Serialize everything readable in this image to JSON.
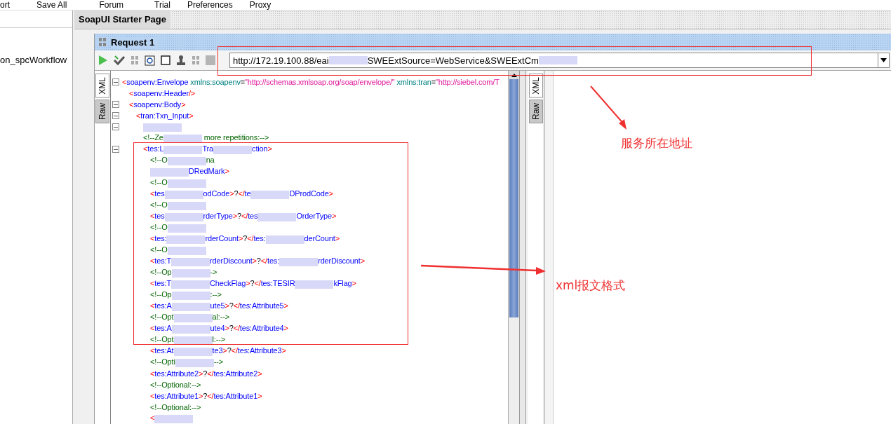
{
  "menu": [
    "ort",
    "Save All",
    "Forum",
    "Trial",
    "Preferences",
    "Proxy"
  ],
  "navigator": {
    "item": "on_spcWorkflow"
  },
  "tabs": [
    {
      "label": "SoapUI Starter Page",
      "selected": true
    }
  ],
  "request": {
    "title": "Request 1",
    "url_parts": [
      {
        "kind": "text",
        "text": "http://172.19.100.88/eai"
      },
      {
        "kind": "redacted"
      },
      {
        "kind": "text",
        "text": "SWEExtSource=WebService&SWEExtCm"
      },
      {
        "kind": "redacted"
      }
    ]
  },
  "editor_tabs": [
    {
      "label": "XML",
      "selected": true
    },
    {
      "label": "Raw",
      "selected": false
    }
  ],
  "response_tabs": [
    {
      "label": "XML",
      "selected": true
    },
    {
      "label": "Raw",
      "selected": false
    }
  ],
  "lines": [
    {
      "fold": true,
      "parts": [
        {
          "kind": "punct",
          "text": "<"
        },
        {
          "kind": "name",
          "text": "soapenv:Envelope"
        },
        {
          "kind": "attr",
          "text": " xmlns:soapenv"
        },
        {
          "kind": "plain",
          "text": "="
        },
        {
          "kind": "value",
          "text": "\"http://schemas.xmlsoap.org/soap/envelope/\""
        },
        {
          "kind": "attr",
          "text": " xmlns:tran"
        },
        {
          "kind": "plain",
          "text": "="
        },
        {
          "kind": "value",
          "text": "\"http://siebel.com/T"
        }
      ],
      "children": [
        {
          "parts": [
            {
              "kind": "punct",
              "text": "<"
            },
            {
              "kind": "name",
              "text": "soapenv:Header"
            },
            {
              "kind": "punct",
              "text": "/>"
            }
          ]
        },
        {
          "fold": true,
          "parts": [
            {
              "kind": "punct",
              "text": "<"
            },
            {
              "kind": "name",
              "text": "soapenv:Body"
            },
            {
              "kind": "punct",
              "text": ">"
            }
          ],
          "children": [
            {
              "fold": true,
              "parts": [
                {
                  "kind": "punct",
                  "text": "<"
                },
                {
                  "kind": "name",
                  "text": "tran:Txn_Input"
                },
                {
                  "kind": "punct",
                  "text": ">"
                }
              ],
              "children": [
                {
                  "fold": true,
                  "parts": [
                    {
                      "kind": "redacted"
                    }
                  ]
                },
                {
                  "parts": [
                    {
                      "kind": "comment",
                      "text": "<!--Ze"
                    },
                    {
                      "kind": "redacted"
                    },
                    {
                      "kind": "comment",
                      "text": " more repetitions:-->"
                    }
                  ]
                },
                {
                  "fold": true,
                  "parts": [
                    {
                      "kind": "punct",
                      "text": "<"
                    },
                    {
                      "kind": "name",
                      "text": "tes:L"
                    },
                    {
                      "kind": "redacted"
                    },
                    {
                      "kind": "name",
                      "text": "Tra"
                    },
                    {
                      "kind": "redacted"
                    },
                    {
                      "kind": "name",
                      "text": "ction"
                    },
                    {
                      "kind": "punct",
                      "text": ">"
                    }
                  ],
                  "children": [
                    {
                      "parts": [
                        {
                          "kind": "comment",
                          "text": "<!--O"
                        },
                        {
                          "kind": "redacted"
                        },
                        {
                          "kind": "comment",
                          "text": "na"
                        }
                      ]
                    },
                    {
                      "parts": [
                        {
                          "kind": "redacted"
                        },
                        {
                          "kind": "name",
                          "text": "DRedMark"
                        },
                        {
                          "kind": "punct",
                          "text": ">"
                        }
                      ]
                    },
                    {
                      "parts": [
                        {
                          "kind": "comment",
                          "text": "<!--O"
                        },
                        {
                          "kind": "redacted"
                        }
                      ]
                    },
                    {
                      "parts": [
                        {
                          "kind": "punct",
                          "text": "<"
                        },
                        {
                          "kind": "name",
                          "text": "tes"
                        },
                        {
                          "kind": "redacted"
                        },
                        {
                          "kind": "name",
                          "text": "odCode"
                        },
                        {
                          "kind": "punct",
                          "text": ">"
                        },
                        {
                          "kind": "plain",
                          "text": "?"
                        },
                        {
                          "kind": "punct",
                          "text": "</"
                        },
                        {
                          "kind": "name",
                          "text": "te"
                        },
                        {
                          "kind": "redacted"
                        },
                        {
                          "kind": "name",
                          "text": "DProdCode"
                        },
                        {
                          "kind": "punct",
                          "text": ">"
                        }
                      ]
                    },
                    {
                      "parts": [
                        {
                          "kind": "comment",
                          "text": "<!--O"
                        },
                        {
                          "kind": "redacted"
                        }
                      ]
                    },
                    {
                      "parts": [
                        {
                          "kind": "punct",
                          "text": "<"
                        },
                        {
                          "kind": "name",
                          "text": "tes"
                        },
                        {
                          "kind": "redacted"
                        },
                        {
                          "kind": "name",
                          "text": "rderType"
                        },
                        {
                          "kind": "punct",
                          "text": ">"
                        },
                        {
                          "kind": "plain",
                          "text": "?"
                        },
                        {
                          "kind": "punct",
                          "text": "</"
                        },
                        {
                          "kind": "name",
                          "text": "tes"
                        },
                        {
                          "kind": "redacted"
                        },
                        {
                          "kind": "name",
                          "text": "OrderType"
                        },
                        {
                          "kind": "punct",
                          "text": ">"
                        }
                      ]
                    },
                    {
                      "parts": [
                        {
                          "kind": "comment",
                          "text": "<!--O"
                        },
                        {
                          "kind": "redacted"
                        }
                      ]
                    },
                    {
                      "parts": [
                        {
                          "kind": "punct",
                          "text": "<"
                        },
                        {
                          "kind": "name",
                          "text": "tes:"
                        },
                        {
                          "kind": "redacted"
                        },
                        {
                          "kind": "name",
                          "text": "rderCount"
                        },
                        {
                          "kind": "punct",
                          "text": ">"
                        },
                        {
                          "kind": "plain",
                          "text": "?"
                        },
                        {
                          "kind": "punct",
                          "text": "</"
                        },
                        {
                          "kind": "name",
                          "text": "tes:"
                        },
                        {
                          "kind": "redacted"
                        },
                        {
                          "kind": "name",
                          "text": "derCount"
                        },
                        {
                          "kind": "punct",
                          "text": ">"
                        }
                      ]
                    },
                    {
                      "parts": [
                        {
                          "kind": "comment",
                          "text": "<!--O"
                        },
                        {
                          "kind": "redacted"
                        }
                      ]
                    },
                    {
                      "parts": [
                        {
                          "kind": "punct",
                          "text": "<"
                        },
                        {
                          "kind": "name",
                          "text": "tes:T"
                        },
                        {
                          "kind": "redacted"
                        },
                        {
                          "kind": "name",
                          "text": "rderDiscount"
                        },
                        {
                          "kind": "punct",
                          "text": ">"
                        },
                        {
                          "kind": "plain",
                          "text": "?"
                        },
                        {
                          "kind": "punct",
                          "text": "</"
                        },
                        {
                          "kind": "name",
                          "text": "tes:"
                        },
                        {
                          "kind": "redacted"
                        },
                        {
                          "kind": "name",
                          "text": "rderDiscount"
                        },
                        {
                          "kind": "punct",
                          "text": ">"
                        }
                      ]
                    },
                    {
                      "parts": [
                        {
                          "kind": "comment",
                          "text": "<!--Op"
                        },
                        {
                          "kind": "redacted"
                        },
                        {
                          "kind": "comment",
                          "text": "->"
                        }
                      ]
                    },
                    {
                      "parts": [
                        {
                          "kind": "punct",
                          "text": "<"
                        },
                        {
                          "kind": "name",
                          "text": "tes:T"
                        },
                        {
                          "kind": "redacted"
                        },
                        {
                          "kind": "name",
                          "text": "CheckFlag"
                        },
                        {
                          "kind": "punct",
                          "text": ">"
                        },
                        {
                          "kind": "plain",
                          "text": "?"
                        },
                        {
                          "kind": "punct",
                          "text": "</"
                        },
                        {
                          "kind": "name",
                          "text": "tes:TESIR"
                        },
                        {
                          "kind": "redacted"
                        },
                        {
                          "kind": "name",
                          "text": "kFlag"
                        },
                        {
                          "kind": "punct",
                          "text": ">"
                        }
                      ]
                    },
                    {
                      "parts": [
                        {
                          "kind": "comment",
                          "text": "<!--Op"
                        },
                        {
                          "kind": "redacted"
                        },
                        {
                          "kind": "comment",
                          "text": ":-->"
                        }
                      ]
                    },
                    {
                      "parts": [
                        {
                          "kind": "punct",
                          "text": "<"
                        },
                        {
                          "kind": "name",
                          "text": "tes:A"
                        },
                        {
                          "kind": "redacted"
                        },
                        {
                          "kind": "name",
                          "text": "ute5"
                        },
                        {
                          "kind": "punct",
                          "text": ">"
                        },
                        {
                          "kind": "plain",
                          "text": "?"
                        },
                        {
                          "kind": "punct",
                          "text": "</"
                        },
                        {
                          "kind": "name",
                          "text": "tes:Attribute5"
                        },
                        {
                          "kind": "punct",
                          "text": ">"
                        }
                      ]
                    },
                    {
                      "parts": [
                        {
                          "kind": "comment",
                          "text": "<!--Opt"
                        },
                        {
                          "kind": "redacted"
                        },
                        {
                          "kind": "comment",
                          "text": "al:-->"
                        }
                      ]
                    },
                    {
                      "parts": [
                        {
                          "kind": "punct",
                          "text": "<"
                        },
                        {
                          "kind": "name",
                          "text": "tes:A"
                        },
                        {
                          "kind": "redacted"
                        },
                        {
                          "kind": "name",
                          "text": "ute4"
                        },
                        {
                          "kind": "punct",
                          "text": ">"
                        },
                        {
                          "kind": "plain",
                          "text": "?"
                        },
                        {
                          "kind": "punct",
                          "text": "</"
                        },
                        {
                          "kind": "name",
                          "text": "tes:Attribute4"
                        },
                        {
                          "kind": "punct",
                          "text": ">"
                        }
                      ]
                    },
                    {
                      "parts": [
                        {
                          "kind": "comment",
                          "text": "<!--Opt"
                        },
                        {
                          "kind": "redacted"
                        },
                        {
                          "kind": "comment",
                          "text": "l:-->"
                        }
                      ]
                    },
                    {
                      "parts": [
                        {
                          "kind": "punct",
                          "text": "<"
                        },
                        {
                          "kind": "name",
                          "text": "tes:At"
                        },
                        {
                          "kind": "redacted"
                        },
                        {
                          "kind": "name",
                          "text": "te3"
                        },
                        {
                          "kind": "punct",
                          "text": ">"
                        },
                        {
                          "kind": "plain",
                          "text": "?"
                        },
                        {
                          "kind": "punct",
                          "text": "</"
                        },
                        {
                          "kind": "name",
                          "text": "tes:Attribute3"
                        },
                        {
                          "kind": "punct",
                          "text": ">"
                        }
                      ]
                    },
                    {
                      "parts": [
                        {
                          "kind": "comment",
                          "text": "<!--Opti"
                        },
                        {
                          "kind": "redacted"
                        },
                        {
                          "kind": "comment",
                          "text": "-->"
                        }
                      ]
                    },
                    {
                      "parts": [
                        {
                          "kind": "punct",
                          "text": "<"
                        },
                        {
                          "kind": "name",
                          "text": "tes:Attribute2"
                        },
                        {
                          "kind": "punct",
                          "text": ">"
                        },
                        {
                          "kind": "plain",
                          "text": "?"
                        },
                        {
                          "kind": "punct",
                          "text": "</"
                        },
                        {
                          "kind": "name",
                          "text": "tes:Attribute2"
                        },
                        {
                          "kind": "punct",
                          "text": ">"
                        }
                      ]
                    },
                    {
                      "parts": [
                        {
                          "kind": "comment",
                          "text": "<!--Optional:-->"
                        }
                      ]
                    },
                    {
                      "parts": [
                        {
                          "kind": "punct",
                          "text": "<"
                        },
                        {
                          "kind": "name",
                          "text": "tes:Attribute1"
                        },
                        {
                          "kind": "punct",
                          "text": ">"
                        },
                        {
                          "kind": "plain",
                          "text": "?"
                        },
                        {
                          "kind": "punct",
                          "text": "</"
                        },
                        {
                          "kind": "name",
                          "text": "tes:Attribute1"
                        },
                        {
                          "kind": "punct",
                          "text": ">"
                        }
                      ]
                    },
                    {
                      "parts": [
                        {
                          "kind": "comment",
                          "text": "<!--Optional:-->"
                        }
                      ]
                    },
                    {
                      "parts": [
                        {
                          "kind": "punct",
                          "text": "<"
                        },
                        {
                          "kind": "redacted"
                        }
                      ]
                    }
                  ]
                }
              ]
            }
          ]
        }
      ]
    }
  ],
  "annotations": [
    {
      "kind": "url",
      "text": "服务所在地址"
    },
    {
      "kind": "xml",
      "text": "xml报文格式"
    }
  ]
}
